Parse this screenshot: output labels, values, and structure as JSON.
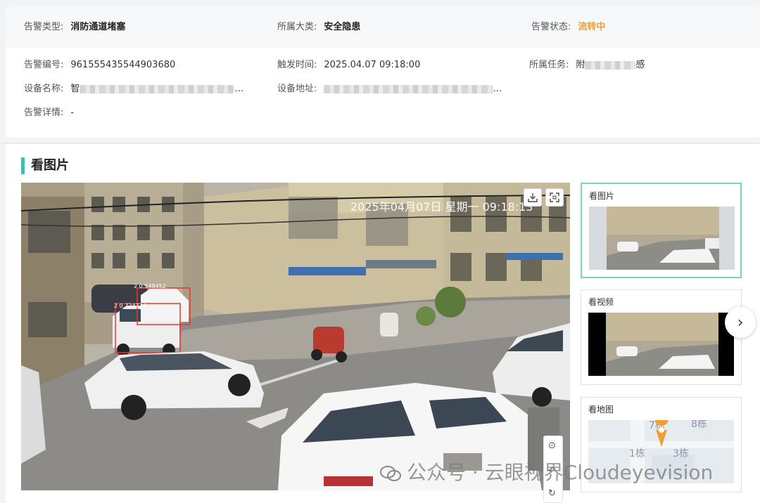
{
  "summary": {
    "alarm_type_label": "告警类型:",
    "alarm_type_value": "消防通道堵塞",
    "category_label": "所属大类:",
    "category_value": "安全隐患",
    "status_label": "告警状态:",
    "status_value": "流转中",
    "status_color": "#f0a030"
  },
  "details": {
    "alarm_id_label": "告警编号:",
    "alarm_id_value": "961555435544903680",
    "trigger_time_label": "触发时间:",
    "trigger_time_value": "2025.04.07 09:18:00",
    "task_label": "所属任务:",
    "task_value_prefix": "附",
    "task_value_suffix": "感",
    "device_name_label": "设备名称:",
    "device_name_prefix": "智",
    "device_name_suffix": "…",
    "device_addr_label": "设备地址:",
    "device_addr_suffix": "…",
    "alarm_detail_label": "告警详情:",
    "alarm_detail_value": "-"
  },
  "section": {
    "title": "看图片",
    "accent": "#3cc1b0"
  },
  "viewer": {
    "overlay_date": "2025年04月07日  星期一  09:18:13",
    "detections": [
      "2 0.548452",
      "2 0.724734"
    ],
    "download_icon": "download-icon",
    "fullscreen_icon": "fullscreen-icon"
  },
  "side_tools": [
    "zoom-icon",
    "rotate-icon"
  ],
  "thumbnails": [
    {
      "label": "看图片",
      "active": true
    },
    {
      "label": "看视频",
      "active": false
    },
    {
      "label": "看地图",
      "active": false
    }
  ],
  "map": {
    "labels": [
      "7栋",
      "8栋",
      "1栋",
      "3栋"
    ],
    "pin_color": "#f0a030"
  },
  "next_icon": "›",
  "watermark": {
    "text": "公众号 · 云眼视界Cloudeyevision"
  }
}
